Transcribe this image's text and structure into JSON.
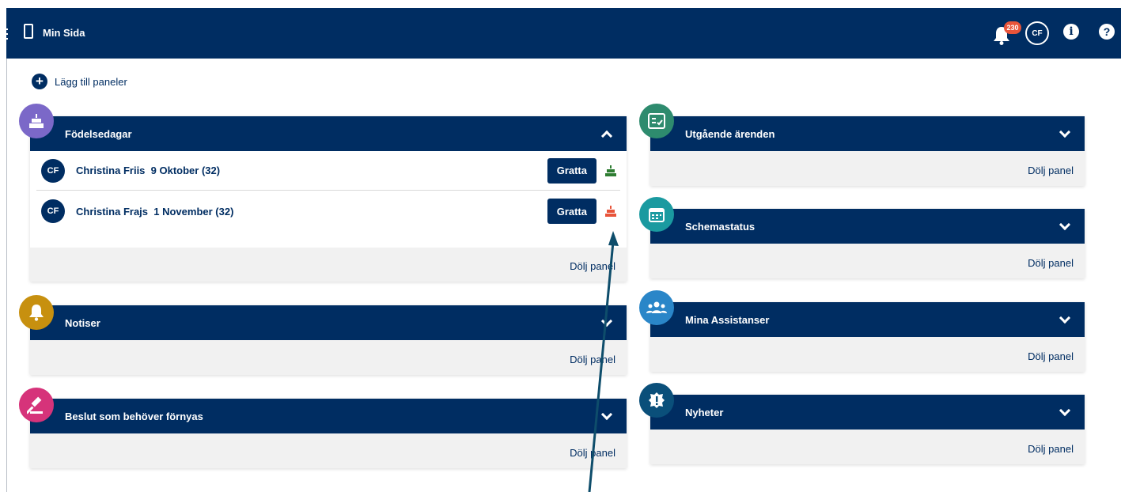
{
  "header": {
    "app_title": "Min Sida",
    "notification_count": "230",
    "user_initials": "CF",
    "info_symbol": "i",
    "help_symbol": "?"
  },
  "add_panels": {
    "label": "Lägg till paneler",
    "icon": "plus-circle-icon"
  },
  "hide_label": "Dölj panel",
  "left_panels": [
    {
      "title": "Födelsedagar",
      "icon": "cake-icon",
      "icon_color": "#7b68c8",
      "expanded": true,
      "entries": [
        {
          "initials": "CF",
          "name": "Christina Friis",
          "date": "9 Oktober (32)",
          "button": "Gratta",
          "cake_color": "#2e7d32"
        },
        {
          "initials": "CF",
          "name": "Christina Frajs",
          "date": "1 November (32)",
          "button": "Gratta",
          "cake_color": "#e8543a"
        }
      ]
    },
    {
      "title": "Notiser",
      "icon": "bell-icon",
      "icon_color": "#c7900f",
      "expanded": false
    },
    {
      "title": "Beslut som behöver förnyas",
      "icon": "gavel-icon",
      "icon_color": "#d6337a",
      "expanded": false
    }
  ],
  "right_panels": [
    {
      "title": "Utgående ärenden",
      "icon": "checklist-icon",
      "icon_color": "#2e8b6e",
      "expanded": false
    },
    {
      "title": "Schemastatus",
      "icon": "calendar-icon",
      "icon_color": "#1a9aa0",
      "expanded": false
    },
    {
      "title": "Mina Assistanser",
      "icon": "users-icon",
      "icon_color": "#2a86c8",
      "expanded": false
    },
    {
      "title": "Nyheter",
      "icon": "alert-badge-icon",
      "icon_color": "#0a4f7a",
      "expanded": false
    }
  ],
  "colors": {
    "navy": "#002d62",
    "panel_bg": "#f1f1f1"
  }
}
